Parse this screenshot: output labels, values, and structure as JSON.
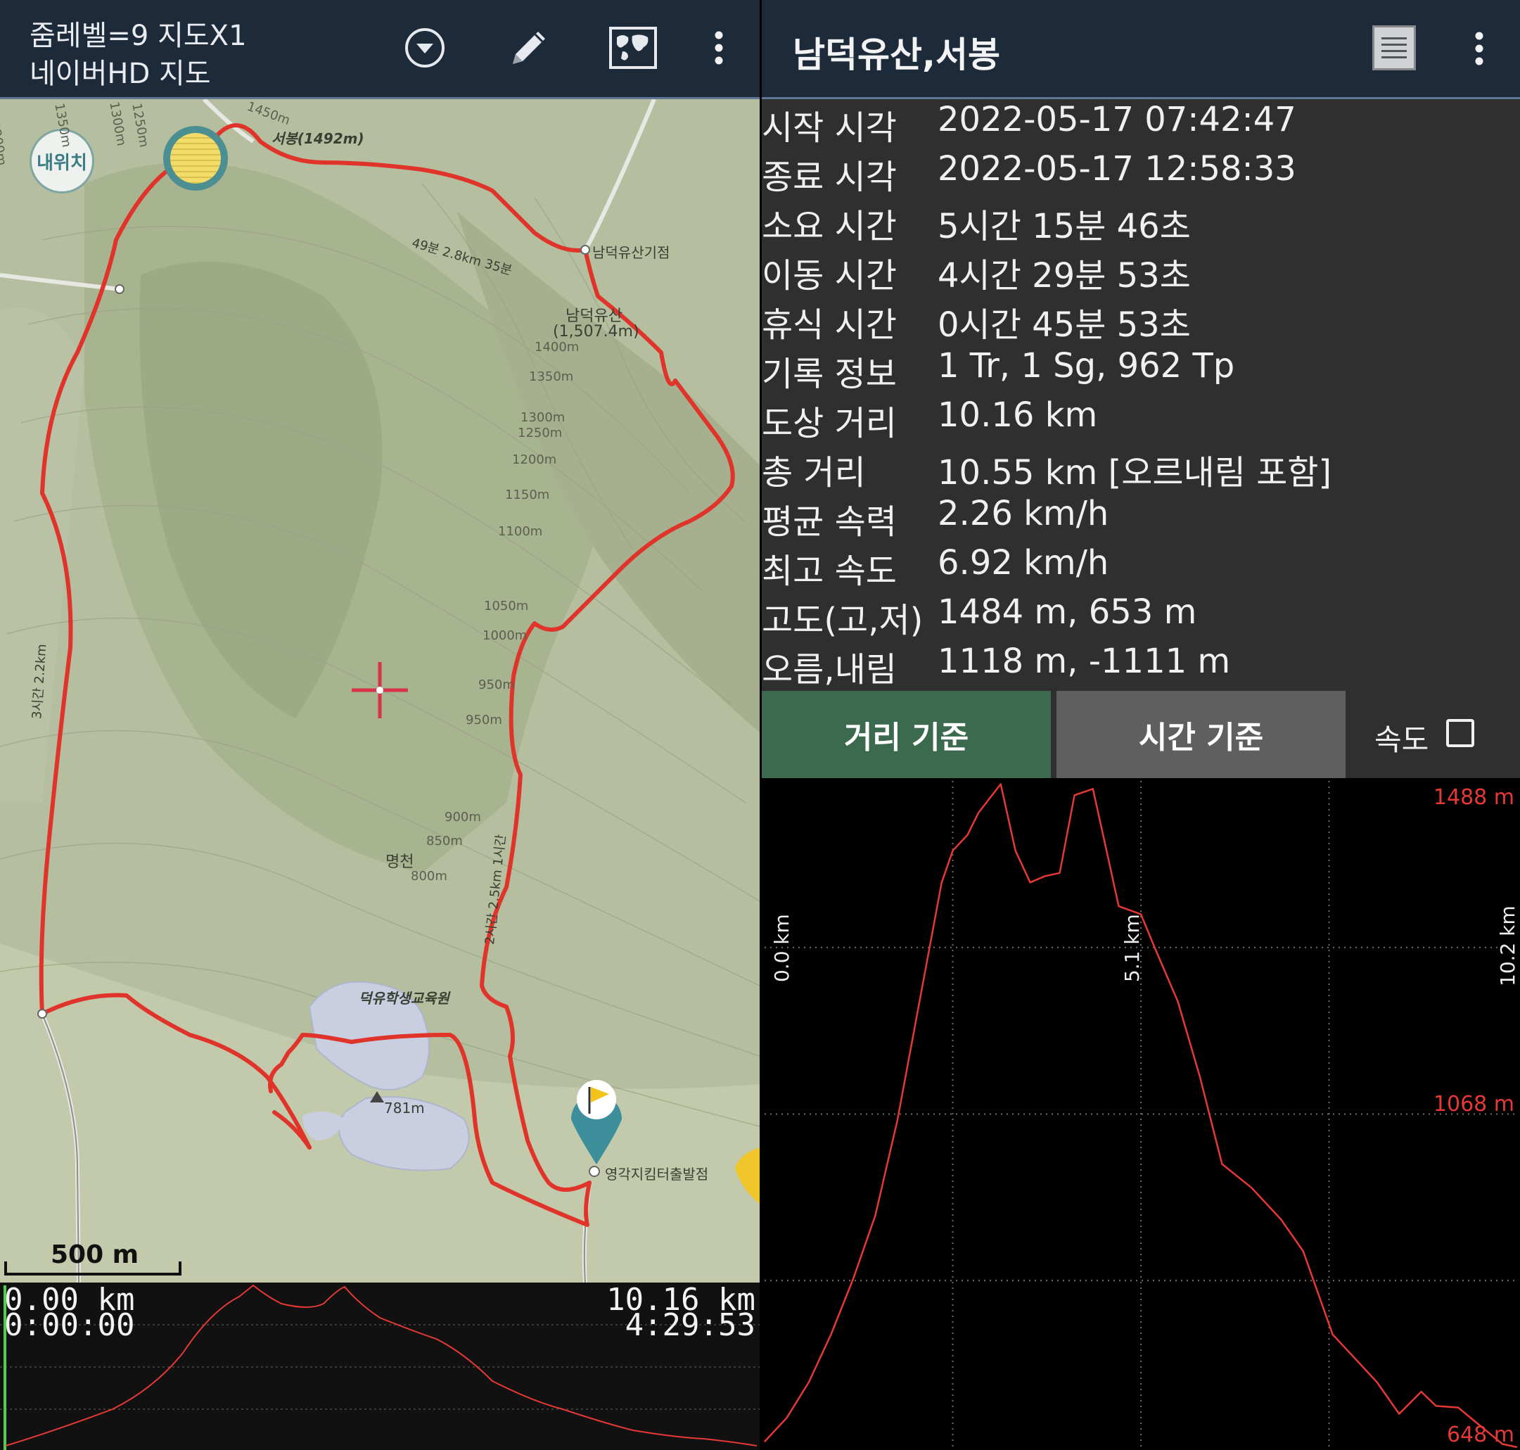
{
  "map_panel": {
    "header": {
      "zoom_text": "줌레벨=9 지도X1",
      "map_name": "네이버HD 지도",
      "icons": [
        "dropdown-circle-icon",
        "pencil-icon",
        "world-map-icon",
        "more-vert-icon"
      ]
    },
    "my_location_label": "내위치",
    "labels": {
      "peak_west": "서봉(1492m)",
      "junction": "남덕유산기점",
      "peak_main_name": "남덕유산",
      "peak_main_height": "(1,507.4m)",
      "stream": "명천",
      "education_center": "덕유학생교육원",
      "spot_height": "781m",
      "trailhead": "영각지킴터출발점",
      "trail_e": "49분 2.8km 35분",
      "trail_w": "3시간 2.2km",
      "trail_s": "2시간 2.5km 1시간"
    },
    "contour_labels": [
      "1450m",
      "1400m",
      "1350m",
      "1300m",
      "1250m",
      "1200m",
      "1150m",
      "1100m",
      "1050m",
      "1000m",
      "950m",
      "950m",
      "900m",
      "850m",
      "800m",
      "1200m",
      "1300m",
      "1250m",
      "1350m"
    ],
    "scale_bar": "500 m",
    "profile": {
      "start_distance": "0.00 km",
      "start_time": "0:00:00",
      "end_distance": "10.16 km",
      "end_time": "4:29:53"
    }
  },
  "track_panel": {
    "title": "남덕유산,서봉",
    "icons": [
      "list-icon",
      "more-vert-icon"
    ],
    "stats": [
      {
        "label": "시작 시각",
        "value": "2022-05-17 07:42:47"
      },
      {
        "label": "종료 시각",
        "value": "2022-05-17 12:58:33"
      },
      {
        "label": "소요 시간",
        "value": "5시간 15분 46초"
      },
      {
        "label": "이동 시간",
        "value": "4시간 29분 53초"
      },
      {
        "label": "휴식 시간",
        "value": "0시간 45분 53초"
      },
      {
        "label": "기록 정보",
        "value": "1 Tr, 1 Sg, 962 Tp"
      },
      {
        "label": "도상 거리",
        "value": "10.16 km"
      },
      {
        "label": "총 거리",
        "value": "10.55 km [오르내림 포함]"
      },
      {
        "label": "평균 속력",
        "value": "2.26 km/h"
      },
      {
        "label": "최고 속도",
        "value": "6.92 km/h"
      },
      {
        "label": "고도(고,저)",
        "value": "1484 m, 653 m"
      },
      {
        "label": "오름,내림",
        "value": "1118 m, -1111 m"
      }
    ],
    "tabs": {
      "distance": "거리 기준",
      "time": "시간 기준",
      "speed": "속도",
      "speed_checked": false,
      "active": "distance"
    },
    "colors": {
      "line": "#e53935",
      "active_tab": "#3b6a4e",
      "inactive_tab": "#5f5f5f"
    }
  },
  "chart_data": {
    "type": "line",
    "xlabel": "",
    "ylabel": "",
    "x_tick_labels": [
      "0.0 km",
      "5.1 km",
      "10.2 km"
    ],
    "y_tick_labels": [
      "1488 m",
      "1068 m",
      "648 m"
    ],
    "xlim": [
      0,
      10.2
    ],
    "ylim": [
      648,
      1488
    ],
    "grid": true,
    "series": [
      {
        "x": [
          0,
          0.3,
          0.6,
          0.9,
          1.2,
          1.5,
          1.8,
          2.1,
          2.4,
          2.55,
          2.75,
          2.9,
          3.2,
          3.4,
          3.6,
          3.8,
          4.0,
          4.2,
          4.45,
          4.6,
          4.8,
          5.1,
          5.3,
          5.6,
          5.9,
          6.2,
          6.6,
          7.0,
          7.3,
          7.7,
          8.0,
          8.3,
          8.6,
          8.9,
          9.1,
          9.4,
          9.7,
          10.0,
          10.2
        ],
        "y": [
          655,
          685,
          730,
          790,
          860,
          940,
          1060,
          1210,
          1360,
          1400,
          1420,
          1448,
          1484,
          1400,
          1360,
          1368,
          1372,
          1470,
          1478,
          1415,
          1330,
          1320,
          1275,
          1210,
          1115,
          1005,
          975,
          935,
          895,
          790,
          760,
          730,
          690,
          718,
          700,
          698,
          675,
          652,
          648
        ]
      }
    ]
  }
}
